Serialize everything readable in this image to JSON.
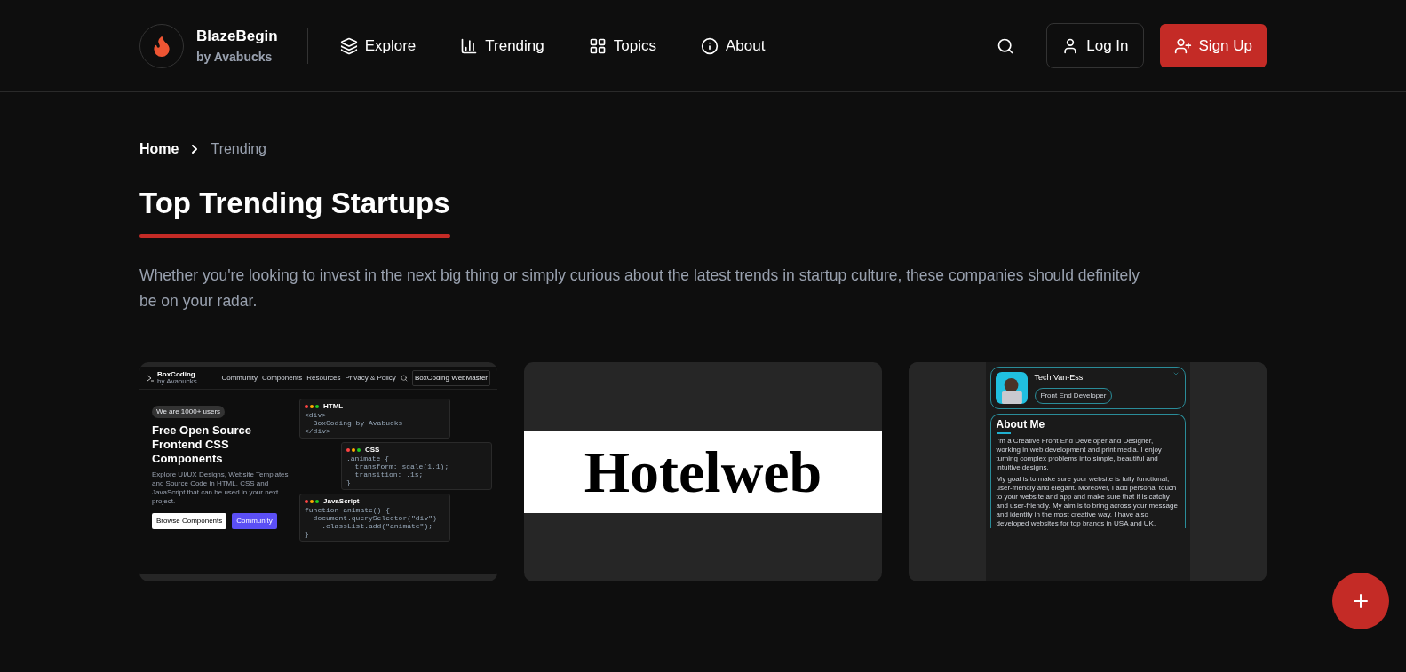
{
  "brand": {
    "name": "BlazeBegin",
    "sub": "by Avabucks"
  },
  "nav": [
    {
      "label": "Explore",
      "kind": "explore"
    },
    {
      "label": "Trending",
      "kind": "trending"
    },
    {
      "label": "Topics",
      "kind": "topics"
    },
    {
      "label": "About",
      "kind": "about"
    }
  ],
  "actions": {
    "login": "Log In",
    "signup": "Sign Up"
  },
  "breadcrumb": [
    {
      "label": "Home",
      "selected": false
    },
    {
      "label": "Trending",
      "selected": true
    }
  ],
  "title": "Top Trending Startups",
  "description": "Whether you're looking to invest in the next big thing or simply curious about the latest trends in startup culture, these companies should definitely be on your radar.",
  "cards": [
    {
      "kind": "site",
      "logo": "BoxCoding",
      "logo_sub": "by Avabucks",
      "links": [
        "Community",
        "Components",
        "Resources",
        "Privacy & Policy"
      ],
      "account": "BoxCoding WebMaster",
      "badge": "We are 1000+ users",
      "heading": "Free Open Source Frontend CSS Components",
      "text": "Explore UI/UX Designs, Website Templates and Source Code in HTML, CSS and JavaScript that can be used in your next project.",
      "buttons": [
        "Browse Components",
        "Community"
      ],
      "windows": [
        {
          "title": "HTML",
          "lines": [
            "<div>",
            "  BoxCoding by Avabucks",
            "</div>"
          ]
        },
        {
          "title": "CSS",
          "lines": [
            ".animate {",
            "  transform: scale(1.1);",
            "  transition: .1s;",
            "}"
          ]
        },
        {
          "title": "JavaScript",
          "lines": [
            "function animate() {",
            "  document.querySelector(\"div\")",
            "    .classList.add(\"animate\");",
            "}"
          ]
        }
      ]
    },
    {
      "kind": "logo",
      "text": "Hotelweb"
    },
    {
      "kind": "profile",
      "name": "Tech Van-Ess",
      "role": "Front End Developer",
      "section": "About Me",
      "paragraphs": [
        "I'm a Creative Front End Developer and Designer, working in web development and print media. I enjoy turning complex problems into simple, beautiful and intuitive designs.",
        "My goal is to make sure your website is fully functional, user-friendly and elegant. Moreover, I add personal touch to your website and app and make sure that it is catchy and user-friendly. My aim is to bring across your message and identity in the most creative way. I have also developed websites for top brands in USA and UK."
      ]
    }
  ]
}
